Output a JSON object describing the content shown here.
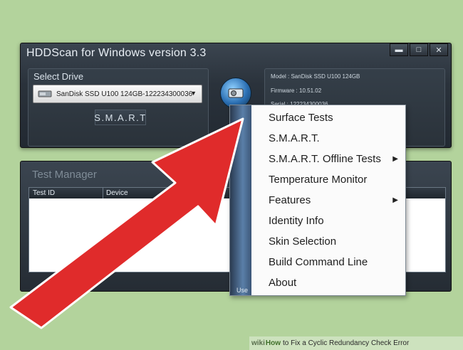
{
  "window": {
    "title": "HDDScan for Windows version 3.3",
    "controls": [
      "▬",
      "□",
      "✕"
    ]
  },
  "select_drive": {
    "label": "Select Drive",
    "selected": "SanDisk SSD U100 124GB-122234300036",
    "smart_button": "S.M.A.R.T"
  },
  "drive_info": {
    "model": "Model : SanDisk SSD U100 124GB",
    "firmware": "Firmware : 10.51.02",
    "serial": "Serial : 122234300036"
  },
  "test_manager": {
    "title": "Test Manager",
    "columns": [
      "Test ID",
      "Device"
    ]
  },
  "context_menu": {
    "strip_text": "Use",
    "items": [
      {
        "label": "Surface Tests",
        "submenu": false
      },
      {
        "label": "S.M.A.R.T.",
        "submenu": false
      },
      {
        "label": "S.M.A.R.T. Offline Tests",
        "submenu": true
      },
      {
        "label": "Temperature Monitor",
        "submenu": false
      },
      {
        "label": "Features",
        "submenu": true
      },
      {
        "label": "Identity Info",
        "submenu": false
      },
      {
        "label": "Skin Selection",
        "submenu": false
      },
      {
        "label": "Build Command Line",
        "submenu": false
      },
      {
        "label": "About",
        "submenu": false
      }
    ]
  },
  "footer": {
    "brand_prefix": "wiki",
    "how": "How",
    "text": "to Fix a Cyclic Redundancy Check Error"
  },
  "colors": {
    "background": "#b3d39c",
    "arrow": "#e02b2b"
  }
}
